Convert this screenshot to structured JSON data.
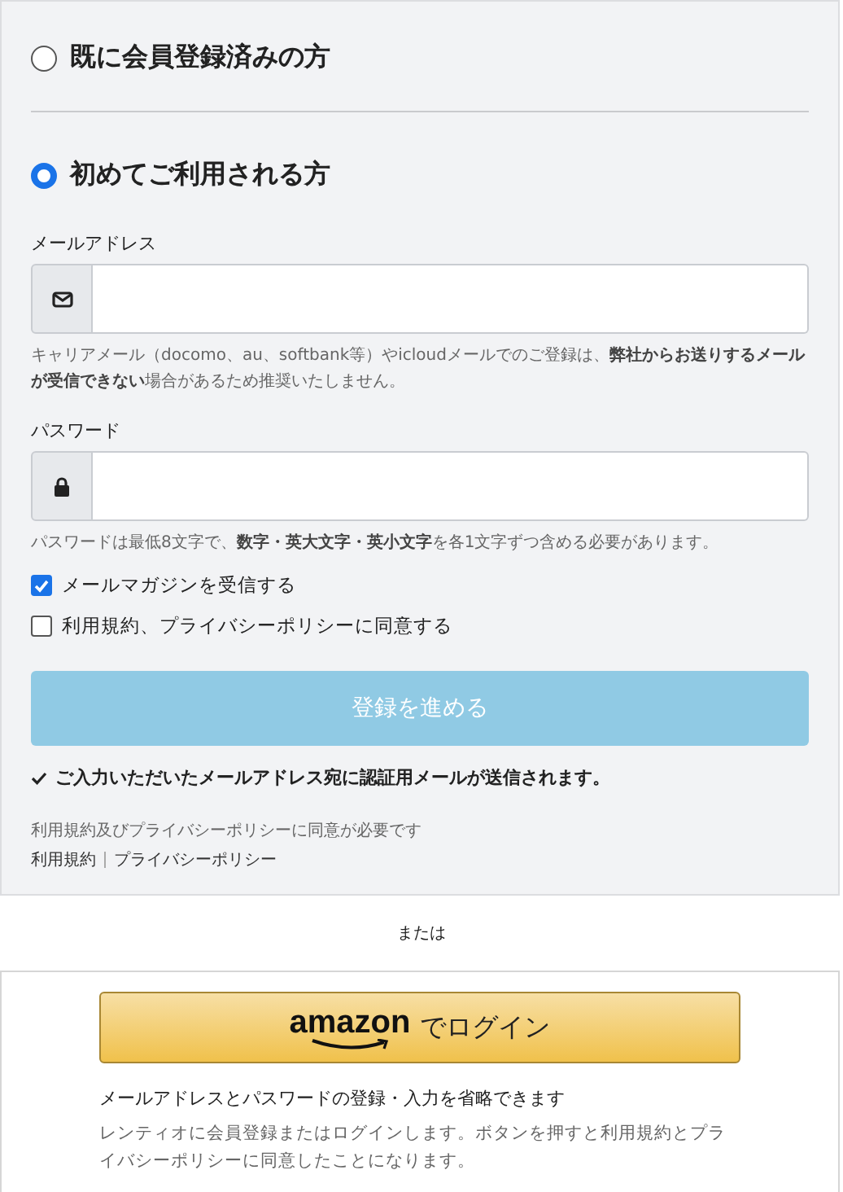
{
  "login_options": [
    {
      "label": "既に会員登録済みの方",
      "selected": false
    },
    {
      "label": "初めてご利用される方",
      "selected": true
    }
  ],
  "email": {
    "label": "メールアドレス",
    "hint": "キャリアメール（docomo、au、softbank等）やicloudメールでのご登録は、**弊社からお送りするメールが受信できない**場合があるため推奨いたしません。"
  },
  "password": {
    "label": "パスワード",
    "hint": "パスワードは最低8文字で、**数字・英大文字・英小文字**を各1文字ずつ含める必要があります。"
  },
  "checkboxes": [
    {
      "label": "メールマガジンを受信する",
      "checked": true
    },
    {
      "label": "利用規約、プライバシーポリシーに同意する",
      "checked": false
    }
  ],
  "submit": {
    "label": "登録を進める",
    "disabled": true
  },
  "notice": "ご入力いただいたメールアドレス宛に認証用メールが送信されます。",
  "consent_note": "利用規約及びプライバシーポリシーに同意が必要です",
  "links": [
    "利用規約",
    "プライバシーポリシー"
  ],
  "separator": "または",
  "amazon": {
    "logo": "amazon",
    "button_label": "でログイン",
    "title": "メールアドレスとパスワードの登録・入力を省略できます",
    "description": "レンティオに会員登録またはログインします。ボタンを押すと利用規約とプライバシーポリシーに同意したことになります。"
  }
}
